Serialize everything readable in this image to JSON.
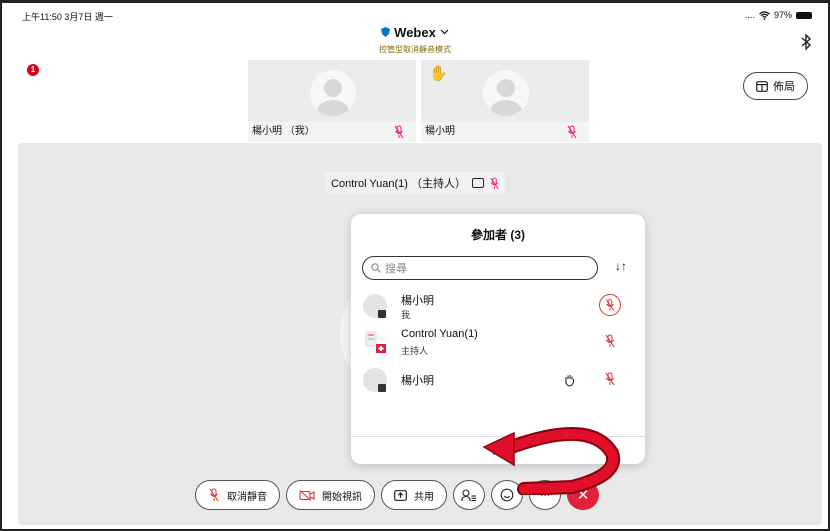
{
  "status": {
    "time_date": "上午11:50  3月7日 週一",
    "signal": "....",
    "battery": "97%"
  },
  "meeting": {
    "app_name": "Webex",
    "mode": "控管型取消靜音模式"
  },
  "notifications": {
    "count": "1"
  },
  "layout_button": {
    "label": "佈局"
  },
  "thumbnails": [
    {
      "name": "楊小明 （我）",
      "hand_raised": false
    },
    {
      "name": "楊小明",
      "hand_raised": true
    }
  ],
  "stage": {
    "host_label": "Control Yuan(1) （主持人）"
  },
  "participants_panel": {
    "title": "參加者 (3)",
    "search_placeholder": "搜尋",
    "sort_icon": "↓↑",
    "rows": [
      {
        "name": "楊小明",
        "role": "我",
        "audio": "muted"
      },
      {
        "name": "Control Yuan(1)",
        "role": "主持人",
        "audio": "muted"
      },
      {
        "name": "楊小明",
        "role": "",
        "audio": "muted"
      }
    ]
  },
  "toolbar": {
    "unmute_label": "取消靜音",
    "video_label": "開始視訊",
    "share_label": "共用",
    "more_label": "···",
    "end_label": "✕"
  },
  "colors": {
    "accent_red": "#e0223a",
    "mute_red": "#d33333",
    "webex_blue": "#0077c8",
    "annotation_arrow": "#d0021b"
  }
}
